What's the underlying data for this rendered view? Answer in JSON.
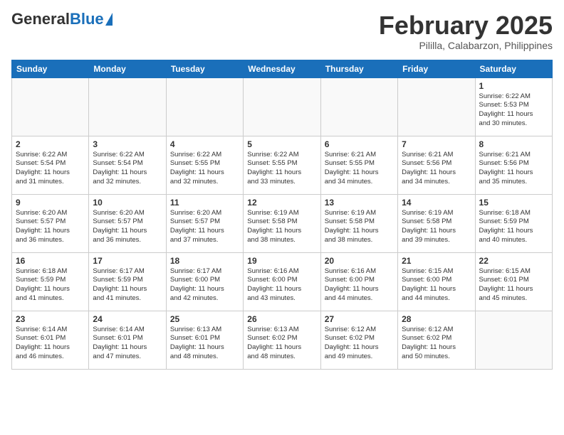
{
  "header": {
    "logo_general": "General",
    "logo_blue": "Blue",
    "title": "February 2025",
    "subtitle": "Pililla, Calabarzon, Philippines"
  },
  "days_of_week": [
    "Sunday",
    "Monday",
    "Tuesday",
    "Wednesday",
    "Thursday",
    "Friday",
    "Saturday"
  ],
  "weeks": [
    [
      {
        "day": "",
        "info": ""
      },
      {
        "day": "",
        "info": ""
      },
      {
        "day": "",
        "info": ""
      },
      {
        "day": "",
        "info": ""
      },
      {
        "day": "",
        "info": ""
      },
      {
        "day": "",
        "info": ""
      },
      {
        "day": "1",
        "info": "Sunrise: 6:22 AM\nSunset: 5:53 PM\nDaylight: 11 hours\nand 30 minutes."
      }
    ],
    [
      {
        "day": "2",
        "info": "Sunrise: 6:22 AM\nSunset: 5:54 PM\nDaylight: 11 hours\nand 31 minutes."
      },
      {
        "day": "3",
        "info": "Sunrise: 6:22 AM\nSunset: 5:54 PM\nDaylight: 11 hours\nand 32 minutes."
      },
      {
        "day": "4",
        "info": "Sunrise: 6:22 AM\nSunset: 5:55 PM\nDaylight: 11 hours\nand 32 minutes."
      },
      {
        "day": "5",
        "info": "Sunrise: 6:22 AM\nSunset: 5:55 PM\nDaylight: 11 hours\nand 33 minutes."
      },
      {
        "day": "6",
        "info": "Sunrise: 6:21 AM\nSunset: 5:55 PM\nDaylight: 11 hours\nand 34 minutes."
      },
      {
        "day": "7",
        "info": "Sunrise: 6:21 AM\nSunset: 5:56 PM\nDaylight: 11 hours\nand 34 minutes."
      },
      {
        "day": "8",
        "info": "Sunrise: 6:21 AM\nSunset: 5:56 PM\nDaylight: 11 hours\nand 35 minutes."
      }
    ],
    [
      {
        "day": "9",
        "info": "Sunrise: 6:20 AM\nSunset: 5:57 PM\nDaylight: 11 hours\nand 36 minutes."
      },
      {
        "day": "10",
        "info": "Sunrise: 6:20 AM\nSunset: 5:57 PM\nDaylight: 11 hours\nand 36 minutes."
      },
      {
        "day": "11",
        "info": "Sunrise: 6:20 AM\nSunset: 5:57 PM\nDaylight: 11 hours\nand 37 minutes."
      },
      {
        "day": "12",
        "info": "Sunrise: 6:19 AM\nSunset: 5:58 PM\nDaylight: 11 hours\nand 38 minutes."
      },
      {
        "day": "13",
        "info": "Sunrise: 6:19 AM\nSunset: 5:58 PM\nDaylight: 11 hours\nand 38 minutes."
      },
      {
        "day": "14",
        "info": "Sunrise: 6:19 AM\nSunset: 5:58 PM\nDaylight: 11 hours\nand 39 minutes."
      },
      {
        "day": "15",
        "info": "Sunrise: 6:18 AM\nSunset: 5:59 PM\nDaylight: 11 hours\nand 40 minutes."
      }
    ],
    [
      {
        "day": "16",
        "info": "Sunrise: 6:18 AM\nSunset: 5:59 PM\nDaylight: 11 hours\nand 41 minutes."
      },
      {
        "day": "17",
        "info": "Sunrise: 6:17 AM\nSunset: 5:59 PM\nDaylight: 11 hours\nand 41 minutes."
      },
      {
        "day": "18",
        "info": "Sunrise: 6:17 AM\nSunset: 6:00 PM\nDaylight: 11 hours\nand 42 minutes."
      },
      {
        "day": "19",
        "info": "Sunrise: 6:16 AM\nSunset: 6:00 PM\nDaylight: 11 hours\nand 43 minutes."
      },
      {
        "day": "20",
        "info": "Sunrise: 6:16 AM\nSunset: 6:00 PM\nDaylight: 11 hours\nand 44 minutes."
      },
      {
        "day": "21",
        "info": "Sunrise: 6:15 AM\nSunset: 6:00 PM\nDaylight: 11 hours\nand 44 minutes."
      },
      {
        "day": "22",
        "info": "Sunrise: 6:15 AM\nSunset: 6:01 PM\nDaylight: 11 hours\nand 45 minutes."
      }
    ],
    [
      {
        "day": "23",
        "info": "Sunrise: 6:14 AM\nSunset: 6:01 PM\nDaylight: 11 hours\nand 46 minutes."
      },
      {
        "day": "24",
        "info": "Sunrise: 6:14 AM\nSunset: 6:01 PM\nDaylight: 11 hours\nand 47 minutes."
      },
      {
        "day": "25",
        "info": "Sunrise: 6:13 AM\nSunset: 6:01 PM\nDaylight: 11 hours\nand 48 minutes."
      },
      {
        "day": "26",
        "info": "Sunrise: 6:13 AM\nSunset: 6:02 PM\nDaylight: 11 hours\nand 48 minutes."
      },
      {
        "day": "27",
        "info": "Sunrise: 6:12 AM\nSunset: 6:02 PM\nDaylight: 11 hours\nand 49 minutes."
      },
      {
        "day": "28",
        "info": "Sunrise: 6:12 AM\nSunset: 6:02 PM\nDaylight: 11 hours\nand 50 minutes."
      },
      {
        "day": "",
        "info": ""
      }
    ]
  ]
}
